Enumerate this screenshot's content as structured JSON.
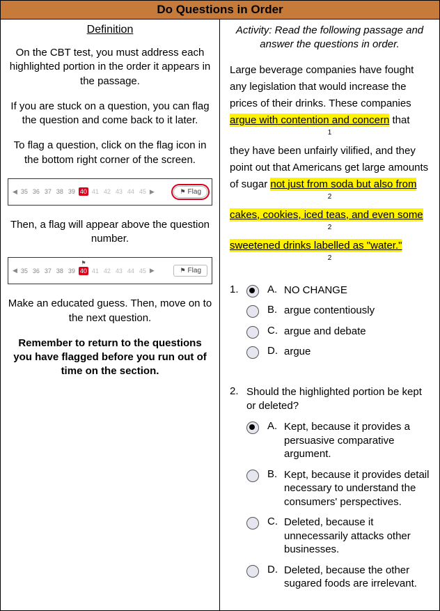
{
  "title": "Do Questions in Order",
  "left": {
    "definition_head": "Definition",
    "p1": "On the CBT test, you must address each highlighted portion in the order it appears in the passage.",
    "p2": "If you are stuck on a question, you can flag the question and come back to it later.",
    "p3": "To flag a question, click on the flag icon in the bottom right corner of the screen.",
    "p4": "Then, a flag will appear above the question number.",
    "p5": "Make an educated guess. Then, move on to the next question.",
    "p6": "Remember to return to the questions you have flagged before you run out of time on the section.",
    "nav": {
      "nums_before": [
        "35",
        "36",
        "37",
        "38",
        "39"
      ],
      "current": "40",
      "nums_after": [
        "41",
        "42",
        "43",
        "44",
        "45"
      ],
      "flag_label": "Flag"
    }
  },
  "right": {
    "activity_head": "Activity: Read the following passage and answer the questions in order.",
    "passage": {
      "t1": "Large beverage companies have fought any legislation that would increase the prices of their drinks. These companies ",
      "h1": "argue with contention and concern",
      "t1b": " that",
      "sub1": "1",
      "t2": "they have been unfairly vilified, and they point out that Americans get large amounts of sugar ",
      "h2": "not just from soda but also from",
      "sub2a": "2",
      "h3": "cakes, cookies, iced teas, and even some",
      "sub2b": "2",
      "h4": "sweetened drinks labelled as \"water.\"",
      "sub2c": "2"
    },
    "q1": {
      "num": "1.",
      "opts": [
        {
          "letter": "A.",
          "text": "NO CHANGE",
          "selected": true
        },
        {
          "letter": "B.",
          "text": "argue contentiously",
          "selected": false
        },
        {
          "letter": "C.",
          "text": "argue and debate",
          "selected": false
        },
        {
          "letter": "D.",
          "text": "argue",
          "selected": false
        }
      ]
    },
    "q2": {
      "num": "2.",
      "stem": "Should the highlighted portion be kept or deleted?",
      "opts": [
        {
          "letter": "A.",
          "text": "Kept, because it provides a persuasive comparative argument.",
          "selected": true
        },
        {
          "letter": "B.",
          "text": "Kept, because it provides detail necessary to understand the consumers' perspectives.",
          "selected": false
        },
        {
          "letter": "C.",
          "text": "Deleted, because it unnecessarily attacks other businesses.",
          "selected": false
        },
        {
          "letter": "D.",
          "text": "Deleted, because the other sugared foods are irrelevant.",
          "selected": false
        }
      ]
    }
  }
}
